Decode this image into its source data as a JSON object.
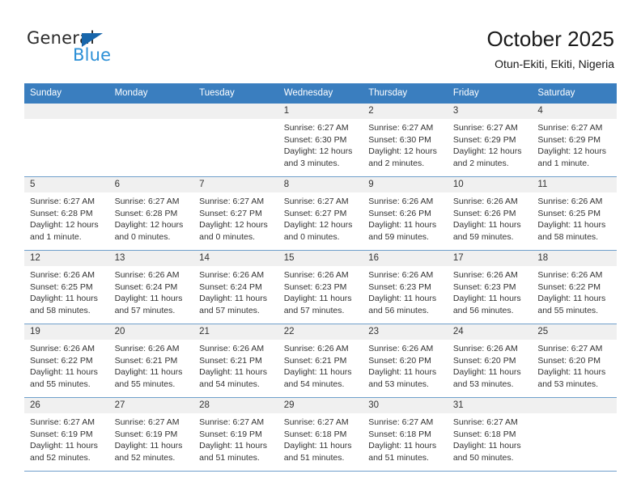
{
  "logo": {
    "line1": "General",
    "line2": "Blue",
    "triangle_color": "#1866ab",
    "line2_color": "#2b8fd6"
  },
  "header": {
    "title": "October 2025",
    "subtitle": "Otun-Ekiti, Ekiti, Nigeria",
    "accent_color": "#3a7ebf"
  },
  "weekdays": [
    "Sunday",
    "Monday",
    "Tuesday",
    "Wednesday",
    "Thursday",
    "Friday",
    "Saturday"
  ],
  "labels": {
    "sunrise": "Sunrise:",
    "sunset": "Sunset:",
    "daylight": "Daylight:"
  },
  "weeks": [
    [
      {
        "day": "",
        "empty": true
      },
      {
        "day": "",
        "empty": true
      },
      {
        "day": "",
        "empty": true
      },
      {
        "day": "1",
        "sunrise": "Sunrise: 6:27 AM",
        "sunset": "Sunset: 6:30 PM",
        "daylight": "Daylight: 12 hours and 3 minutes."
      },
      {
        "day": "2",
        "sunrise": "Sunrise: 6:27 AM",
        "sunset": "Sunset: 6:30 PM",
        "daylight": "Daylight: 12 hours and 2 minutes."
      },
      {
        "day": "3",
        "sunrise": "Sunrise: 6:27 AM",
        "sunset": "Sunset: 6:29 PM",
        "daylight": "Daylight: 12 hours and 2 minutes."
      },
      {
        "day": "4",
        "sunrise": "Sunrise: 6:27 AM",
        "sunset": "Sunset: 6:29 PM",
        "daylight": "Daylight: 12 hours and 1 minute."
      }
    ],
    [
      {
        "day": "5",
        "sunrise": "Sunrise: 6:27 AM",
        "sunset": "Sunset: 6:28 PM",
        "daylight": "Daylight: 12 hours and 1 minute."
      },
      {
        "day": "6",
        "sunrise": "Sunrise: 6:27 AM",
        "sunset": "Sunset: 6:28 PM",
        "daylight": "Daylight: 12 hours and 0 minutes."
      },
      {
        "day": "7",
        "sunrise": "Sunrise: 6:27 AM",
        "sunset": "Sunset: 6:27 PM",
        "daylight": "Daylight: 12 hours and 0 minutes."
      },
      {
        "day": "8",
        "sunrise": "Sunrise: 6:27 AM",
        "sunset": "Sunset: 6:27 PM",
        "daylight": "Daylight: 12 hours and 0 minutes."
      },
      {
        "day": "9",
        "sunrise": "Sunrise: 6:26 AM",
        "sunset": "Sunset: 6:26 PM",
        "daylight": "Daylight: 11 hours and 59 minutes."
      },
      {
        "day": "10",
        "sunrise": "Sunrise: 6:26 AM",
        "sunset": "Sunset: 6:26 PM",
        "daylight": "Daylight: 11 hours and 59 minutes."
      },
      {
        "day": "11",
        "sunrise": "Sunrise: 6:26 AM",
        "sunset": "Sunset: 6:25 PM",
        "daylight": "Daylight: 11 hours and 58 minutes."
      }
    ],
    [
      {
        "day": "12",
        "sunrise": "Sunrise: 6:26 AM",
        "sunset": "Sunset: 6:25 PM",
        "daylight": "Daylight: 11 hours and 58 minutes."
      },
      {
        "day": "13",
        "sunrise": "Sunrise: 6:26 AM",
        "sunset": "Sunset: 6:24 PM",
        "daylight": "Daylight: 11 hours and 57 minutes."
      },
      {
        "day": "14",
        "sunrise": "Sunrise: 6:26 AM",
        "sunset": "Sunset: 6:24 PM",
        "daylight": "Daylight: 11 hours and 57 minutes."
      },
      {
        "day": "15",
        "sunrise": "Sunrise: 6:26 AM",
        "sunset": "Sunset: 6:23 PM",
        "daylight": "Daylight: 11 hours and 57 minutes."
      },
      {
        "day": "16",
        "sunrise": "Sunrise: 6:26 AM",
        "sunset": "Sunset: 6:23 PM",
        "daylight": "Daylight: 11 hours and 56 minutes."
      },
      {
        "day": "17",
        "sunrise": "Sunrise: 6:26 AM",
        "sunset": "Sunset: 6:23 PM",
        "daylight": "Daylight: 11 hours and 56 minutes."
      },
      {
        "day": "18",
        "sunrise": "Sunrise: 6:26 AM",
        "sunset": "Sunset: 6:22 PM",
        "daylight": "Daylight: 11 hours and 55 minutes."
      }
    ],
    [
      {
        "day": "19",
        "sunrise": "Sunrise: 6:26 AM",
        "sunset": "Sunset: 6:22 PM",
        "daylight": "Daylight: 11 hours and 55 minutes."
      },
      {
        "day": "20",
        "sunrise": "Sunrise: 6:26 AM",
        "sunset": "Sunset: 6:21 PM",
        "daylight": "Daylight: 11 hours and 55 minutes."
      },
      {
        "day": "21",
        "sunrise": "Sunrise: 6:26 AM",
        "sunset": "Sunset: 6:21 PM",
        "daylight": "Daylight: 11 hours and 54 minutes."
      },
      {
        "day": "22",
        "sunrise": "Sunrise: 6:26 AM",
        "sunset": "Sunset: 6:21 PM",
        "daylight": "Daylight: 11 hours and 54 minutes."
      },
      {
        "day": "23",
        "sunrise": "Sunrise: 6:26 AM",
        "sunset": "Sunset: 6:20 PM",
        "daylight": "Daylight: 11 hours and 53 minutes."
      },
      {
        "day": "24",
        "sunrise": "Sunrise: 6:26 AM",
        "sunset": "Sunset: 6:20 PM",
        "daylight": "Daylight: 11 hours and 53 minutes."
      },
      {
        "day": "25",
        "sunrise": "Sunrise: 6:27 AM",
        "sunset": "Sunset: 6:20 PM",
        "daylight": "Daylight: 11 hours and 53 minutes."
      }
    ],
    [
      {
        "day": "26",
        "sunrise": "Sunrise: 6:27 AM",
        "sunset": "Sunset: 6:19 PM",
        "daylight": "Daylight: 11 hours and 52 minutes."
      },
      {
        "day": "27",
        "sunrise": "Sunrise: 6:27 AM",
        "sunset": "Sunset: 6:19 PM",
        "daylight": "Daylight: 11 hours and 52 minutes."
      },
      {
        "day": "28",
        "sunrise": "Sunrise: 6:27 AM",
        "sunset": "Sunset: 6:19 PM",
        "daylight": "Daylight: 11 hours and 51 minutes."
      },
      {
        "day": "29",
        "sunrise": "Sunrise: 6:27 AM",
        "sunset": "Sunset: 6:18 PM",
        "daylight": "Daylight: 11 hours and 51 minutes."
      },
      {
        "day": "30",
        "sunrise": "Sunrise: 6:27 AM",
        "sunset": "Sunset: 6:18 PM",
        "daylight": "Daylight: 11 hours and 51 minutes."
      },
      {
        "day": "31",
        "sunrise": "Sunrise: 6:27 AM",
        "sunset": "Sunset: 6:18 PM",
        "daylight": "Daylight: 11 hours and 50 minutes."
      },
      {
        "day": "",
        "empty": true
      }
    ]
  ]
}
